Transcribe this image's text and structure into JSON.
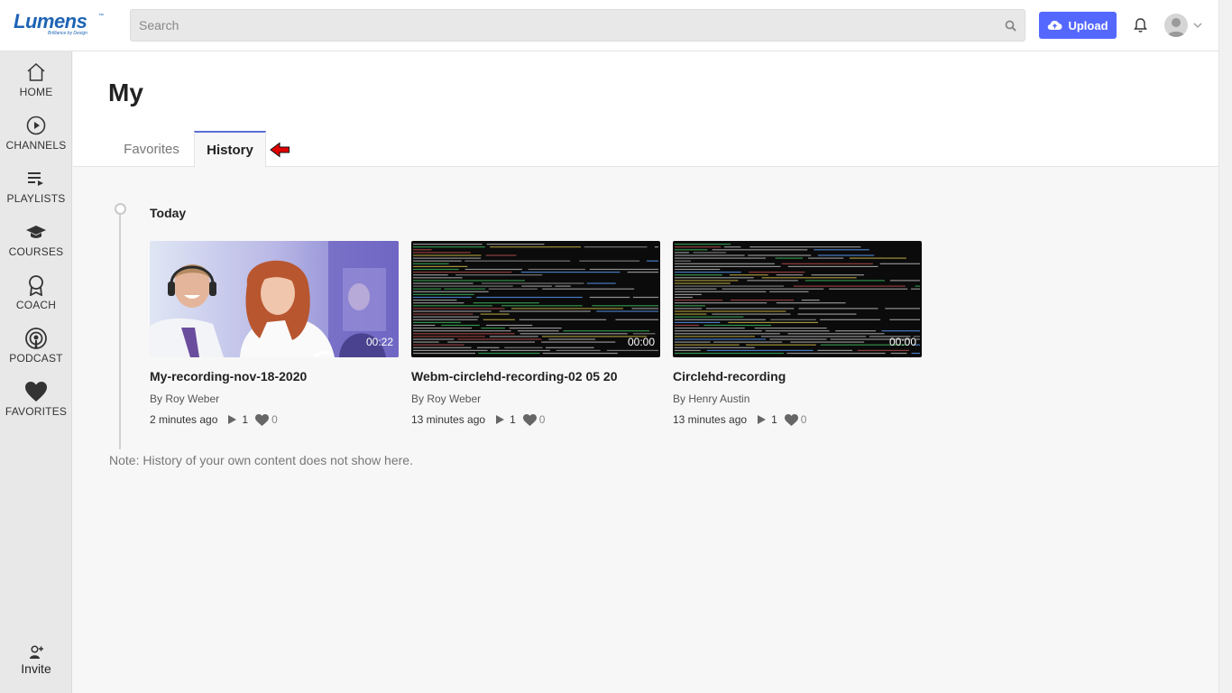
{
  "header": {
    "logo_text": "Lumens",
    "logo_tagline": "Brilliance by Design",
    "logo_tm": "™",
    "search_placeholder": "Search",
    "upload_label": "Upload"
  },
  "sidebar": {
    "items": [
      {
        "label": "HOME",
        "icon": "home-icon"
      },
      {
        "label": "CHANNELS",
        "icon": "play-circle-icon"
      },
      {
        "label": "PLAYLISTS",
        "icon": "playlist-icon"
      },
      {
        "label": "COURSES",
        "icon": "graduation-cap-icon"
      },
      {
        "label": "COACH",
        "icon": "coach-award-icon"
      },
      {
        "label": "PODCAST",
        "icon": "podcast-icon"
      },
      {
        "label": "FAVORITES",
        "icon": "heart-icon"
      }
    ],
    "invite_label": "Invite"
  },
  "page": {
    "title": "My",
    "tabs": [
      {
        "label": "Favorites",
        "active": false
      },
      {
        "label": "History",
        "active": true
      }
    ]
  },
  "history": {
    "day_label": "Today",
    "cards": [
      {
        "title": "My-recording-nov-18-2020",
        "author": "By Roy Weber",
        "duration": "00:22",
        "ago": "2 minutes ago",
        "plays": "1",
        "likes": "0",
        "thumbnail": "people-photo"
      },
      {
        "title": "Webm-circlehd-recording-02 05 20",
        "author": "By Roy Weber",
        "duration": "00:00",
        "ago": "13 minutes ago",
        "plays": "1",
        "likes": "0",
        "thumbnail": "terminal-screenshot"
      },
      {
        "title": "Circlehd-recording",
        "author": "By Henry Austin",
        "duration": "00:00",
        "ago": "13 minutes ago",
        "plays": "1",
        "likes": "0",
        "thumbnail": "terminal-screenshot"
      }
    ],
    "note": "Note: History of your own content does not show here."
  },
  "colors": {
    "accent": "#5468ff",
    "tab_indicator": "#5b6fd6",
    "logo": "#1e64b4",
    "annotation_arrow": "#e00000"
  }
}
